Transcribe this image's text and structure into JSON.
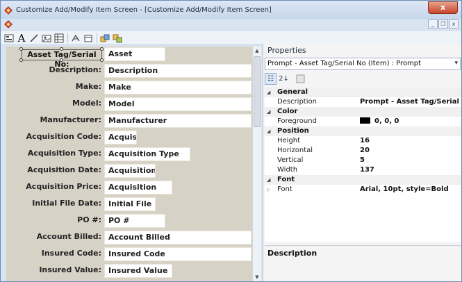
{
  "window": {
    "title": "Customize Add/Modify Item Screen - [Customize Add/Modify Item Screen]",
    "close_label": "x"
  },
  "mdi": {
    "minimize": "_",
    "restore": "❐",
    "close": "x"
  },
  "toolbar": {
    "icons": [
      "form-icon",
      "text-icon",
      "line-icon",
      "image-icon",
      "grid-icon",
      "align-icon",
      "tab-order-icon",
      "copy-icon",
      "paste-icon"
    ],
    "text_label": "A"
  },
  "designer": {
    "selected_prompt": "Asset Tag/Serial No:",
    "rows": [
      {
        "prompt": "Asset Tag/Serial No:",
        "field": "Asset"
      },
      {
        "prompt": "Description:",
        "field": "Description"
      },
      {
        "prompt": "Make:",
        "field": "Make"
      },
      {
        "prompt": "Model:",
        "field": "Model"
      },
      {
        "prompt": "Manufacturer:",
        "field": "Manufacturer"
      },
      {
        "prompt": "Acquisition Code:",
        "field": "Acquisi"
      },
      {
        "prompt": "Acquisition Type:",
        "field": "Acquisition Type"
      },
      {
        "prompt": "Acquisition Date:",
        "field": "Acquisition"
      },
      {
        "prompt": "Acquisition Price:",
        "field": "Acquisition"
      },
      {
        "prompt": "Initial File Date:",
        "field": "Initial File"
      },
      {
        "prompt": "PO #:",
        "field": "PO #"
      },
      {
        "prompt": "Account Billed:",
        "field": "Account Billed"
      },
      {
        "prompt": "Insured Code:",
        "field": "Insured Code"
      },
      {
        "prompt": "Insured Value:",
        "field": "Insured Value"
      }
    ]
  },
  "properties": {
    "title": "Properties",
    "selector": "Prompt - Asset Tag/Serial No (Item) : Prompt",
    "tool_categorized": "☷",
    "tool_alpha": "2↓",
    "grid": [
      {
        "kind": "cat",
        "name": "General"
      },
      {
        "kind": "prop",
        "name": "Description",
        "value": "Prompt - Asset Tag/Serial"
      },
      {
        "kind": "cat",
        "name": "Color"
      },
      {
        "kind": "prop",
        "name": "Foreground",
        "value": "0, 0, 0",
        "swatch": "#000000"
      },
      {
        "kind": "cat",
        "name": "Position"
      },
      {
        "kind": "prop",
        "name": "Height",
        "value": "16"
      },
      {
        "kind": "prop",
        "name": "Horizontal",
        "value": "20"
      },
      {
        "kind": "prop",
        "name": "Vertical",
        "value": "5"
      },
      {
        "kind": "prop",
        "name": "Width",
        "value": "137"
      },
      {
        "kind": "cat",
        "name": "Font"
      },
      {
        "kind": "prop",
        "name": "Font",
        "value": "Arial, 10pt, style=Bold",
        "expandable": true
      }
    ],
    "description_label": "Description"
  },
  "colors": {
    "designer_bg": "#d7d2c6",
    "window_frame": "#d8e4f2",
    "close_button": "#c9452b"
  }
}
